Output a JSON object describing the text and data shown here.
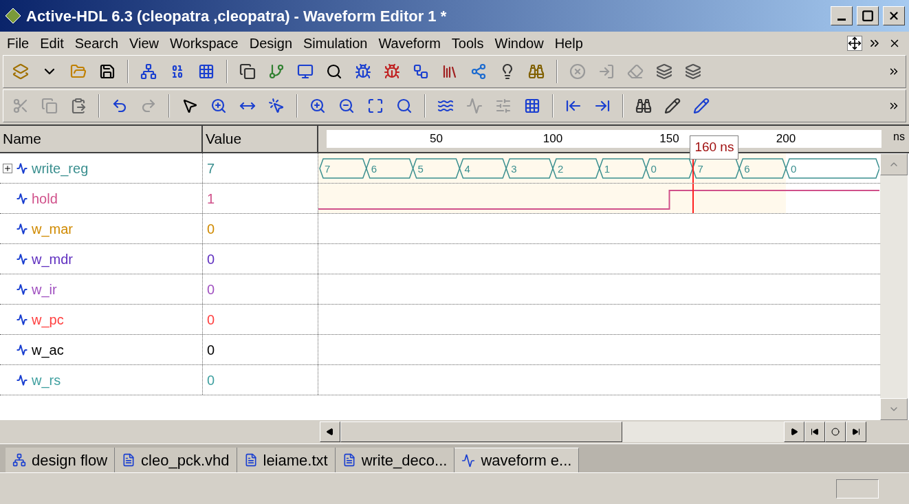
{
  "window": {
    "title": "Active-HDL 6.3 (cleopatra ,cleopatra) - Waveform Editor 1 *"
  },
  "menu": [
    "File",
    "Edit",
    "Search",
    "View",
    "Workspace",
    "Design",
    "Simulation",
    "Waveform",
    "Tools",
    "Window",
    "Help"
  ],
  "columns": [
    "Name",
    "Value"
  ],
  "ruler": {
    "labels": [
      "50",
      "100",
      "150",
      "200"
    ],
    "unit": "ns"
  },
  "cursor": {
    "label": "160 ns"
  },
  "signals": [
    {
      "name": "write_reg",
      "value": "7",
      "color": "#3a8f8f",
      "kind": "bus",
      "expandable": true,
      "segments": [
        "7",
        "6",
        "5",
        "4",
        "3",
        "2",
        "1",
        "0",
        "7",
        "6",
        "0"
      ]
    },
    {
      "name": "hold",
      "value": "1",
      "color": "#d0508a",
      "kind": "bit",
      "expandable": false
    },
    {
      "name": "w_mar",
      "value": "0",
      "color": "#d08a00",
      "kind": "none",
      "expandable": false
    },
    {
      "name": "w_mdr",
      "value": "0",
      "color": "#6030c0",
      "kind": "none",
      "expandable": false
    },
    {
      "name": "w_ir",
      "value": "0",
      "color": "#a050c0",
      "kind": "none",
      "expandable": false
    },
    {
      "name": "w_pc",
      "value": "0",
      "color": "#ff4040",
      "kind": "none",
      "expandable": false
    },
    {
      "name": "w_ac",
      "value": "0",
      "color": "#000000",
      "kind": "none",
      "expandable": false
    },
    {
      "name": "w_rs",
      "value": "0",
      "color": "#40a0a0",
      "kind": "none",
      "expandable": false
    }
  ],
  "tabs": [
    {
      "label": "design flow",
      "selected": false
    },
    {
      "label": "cleo_pck.vhd",
      "selected": false
    },
    {
      "label": "leiame.txt",
      "selected": false
    },
    {
      "label": "write_deco...",
      "selected": false
    },
    {
      "label": "waveform e...",
      "selected": true
    }
  ]
}
